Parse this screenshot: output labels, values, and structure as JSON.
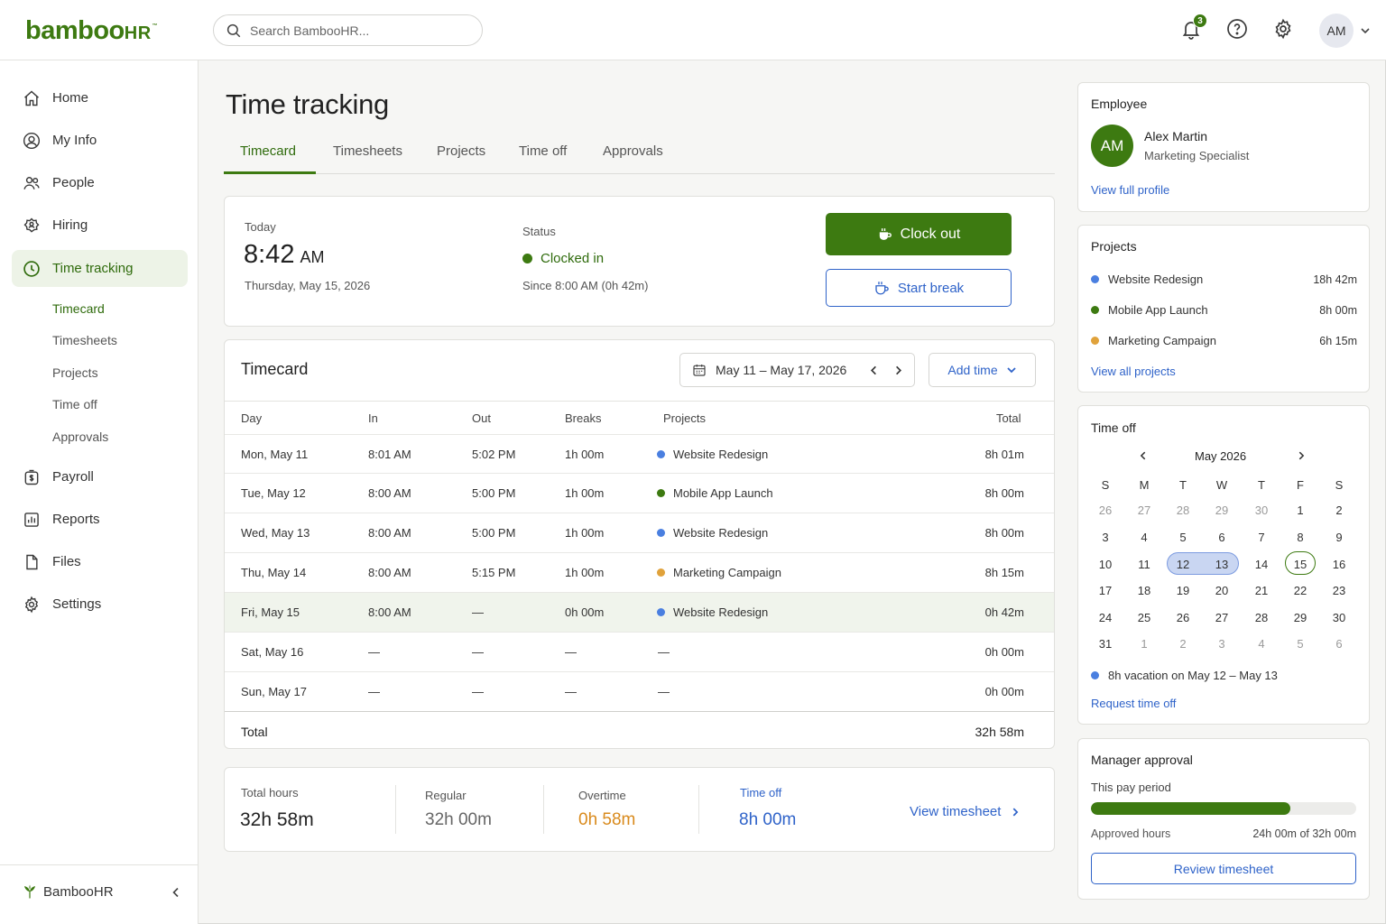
{
  "app": {
    "logo_text": "bamboo",
    "logo_hr": "HR",
    "logo_tm": "™"
  },
  "search": {
    "placeholder": "Search BambooHR..."
  },
  "topbar": {
    "notification_count": "3",
    "user_initials": "AM"
  },
  "sidebar": {
    "items": [
      {
        "label": "Home",
        "icon": "home-icon"
      },
      {
        "label": "My Info",
        "icon": "user-circle-icon"
      },
      {
        "label": "People",
        "icon": "people-icon"
      },
      {
        "label": "Hiring",
        "icon": "hiring-icon"
      },
      {
        "label": "Time tracking",
        "icon": "clock-icon"
      },
      {
        "label": "Payroll",
        "icon": "payroll-icon"
      },
      {
        "label": "Reports",
        "icon": "reports-icon"
      },
      {
        "label": "Files",
        "icon": "file-icon"
      },
      {
        "label": "Settings",
        "icon": "gear-icon"
      }
    ],
    "subitems": [
      "Timecard",
      "Timesheets",
      "Projects",
      "Time off",
      "Approvals"
    ],
    "footer_brand": "BambooHR"
  },
  "page": {
    "title": "Time tracking",
    "tabs": [
      "Timecard",
      "Timesheets",
      "Projects",
      "Time off",
      "Approvals"
    ]
  },
  "today_card": {
    "today_label": "Today",
    "time": "8:42",
    "ampm": "AM",
    "date": "Thursday, May 15, 2026",
    "status_label": "Status",
    "status": "Clocked in",
    "since": "Since 8:00 AM (0h 42m)",
    "clock_out": "Clock out",
    "start_break": "Start break"
  },
  "timecard": {
    "title": "Timecard",
    "range": "May 11 – May 17, 2026",
    "add_time": "Add time",
    "columns": [
      "Day",
      "In",
      "Out",
      "Breaks",
      "Projects",
      "Total"
    ],
    "rows": [
      {
        "day": "Mon, May 11",
        "in": "8:01 AM",
        "out": "5:02 PM",
        "breaks": "1h 00m",
        "project": "Website Redesign",
        "color": "#4a7fe0",
        "total": "8h 01m"
      },
      {
        "day": "Tue, May 12",
        "in": "8:00 AM",
        "out": "5:00 PM",
        "breaks": "1h 00m",
        "project": "Mobile App Launch",
        "color": "#3d7a11",
        "total": "8h 00m"
      },
      {
        "day": "Wed, May 13",
        "in": "8:00 AM",
        "out": "5:00 PM",
        "breaks": "1h 00m",
        "project": "Website Redesign",
        "color": "#4a7fe0",
        "total": "8h 00m"
      },
      {
        "day": "Thu, May 14",
        "in": "8:00 AM",
        "out": "5:15 PM",
        "breaks": "1h 00m",
        "project": "Marketing Campaign",
        "color": "#e0a23b",
        "total": "8h 15m"
      },
      {
        "day": "Fri, May 15",
        "in": "8:00 AM",
        "out": "—",
        "breaks": "0h 00m",
        "project": "Website Redesign",
        "color": "#4a7fe0",
        "total": "0h 42m"
      },
      {
        "day": "Sat, May 16",
        "in": "—",
        "out": "—",
        "breaks": "—",
        "project": "—",
        "color": "",
        "total": "0h 00m"
      },
      {
        "day": "Sun, May 17",
        "in": "—",
        "out": "—",
        "breaks": "—",
        "project": "—",
        "color": "",
        "total": "0h 00m"
      }
    ],
    "total_label": "Total",
    "total_value": "32h 58m"
  },
  "summary": {
    "total_hours_label": "Total hours",
    "total_hours": "32h 58m",
    "regular_label": "Regular",
    "regular": "32h 00m",
    "overtime_label": "Overtime",
    "overtime": "0h 58m",
    "timeoff_label": "Time off",
    "timeoff": "8h 00m",
    "view_timesheet": "View timesheet"
  },
  "employee": {
    "heading": "Employee",
    "initials": "AM",
    "name": "Alex Martin",
    "role": "Marketing Specialist",
    "view_profile": "View full profile"
  },
  "projects_panel": {
    "heading": "Projects",
    "items": [
      {
        "name": "Website Redesign",
        "hours": "18h 42m",
        "color": "#4a7fe0"
      },
      {
        "name": "Mobile App Launch",
        "hours": "8h 00m",
        "color": "#3d7a11"
      },
      {
        "name": "Marketing Campaign",
        "hours": "6h 15m",
        "color": "#e0a23b"
      }
    ],
    "view_all": "View all projects"
  },
  "timeoff_panel": {
    "heading": "Time off",
    "month": "May 2026",
    "weekdays": [
      "S",
      "M",
      "T",
      "W",
      "T",
      "F",
      "S"
    ],
    "weeks": [
      [
        "26",
        "27",
        "28",
        "29",
        "30",
        "1",
        "2"
      ],
      [
        "3",
        "4",
        "5",
        "6",
        "7",
        "8",
        "9"
      ],
      [
        "10",
        "11",
        "12",
        "13",
        "14",
        "15",
        "16"
      ],
      [
        "17",
        "18",
        "19",
        "20",
        "21",
        "22",
        "23"
      ],
      [
        "24",
        "25",
        "26",
        "27",
        "28",
        "29",
        "30"
      ],
      [
        "31",
        "1",
        "2",
        "3",
        "4",
        "5",
        "6"
      ]
    ],
    "note": "8h vacation on May 12 – May 13",
    "request": "Request time off"
  },
  "approval_panel": {
    "heading": "Manager approval",
    "period": "This pay period",
    "progress": 0.75,
    "approved_label": "Approved hours",
    "approved_value": "24h 00m of 32h 00m",
    "review": "Review timesheet"
  }
}
